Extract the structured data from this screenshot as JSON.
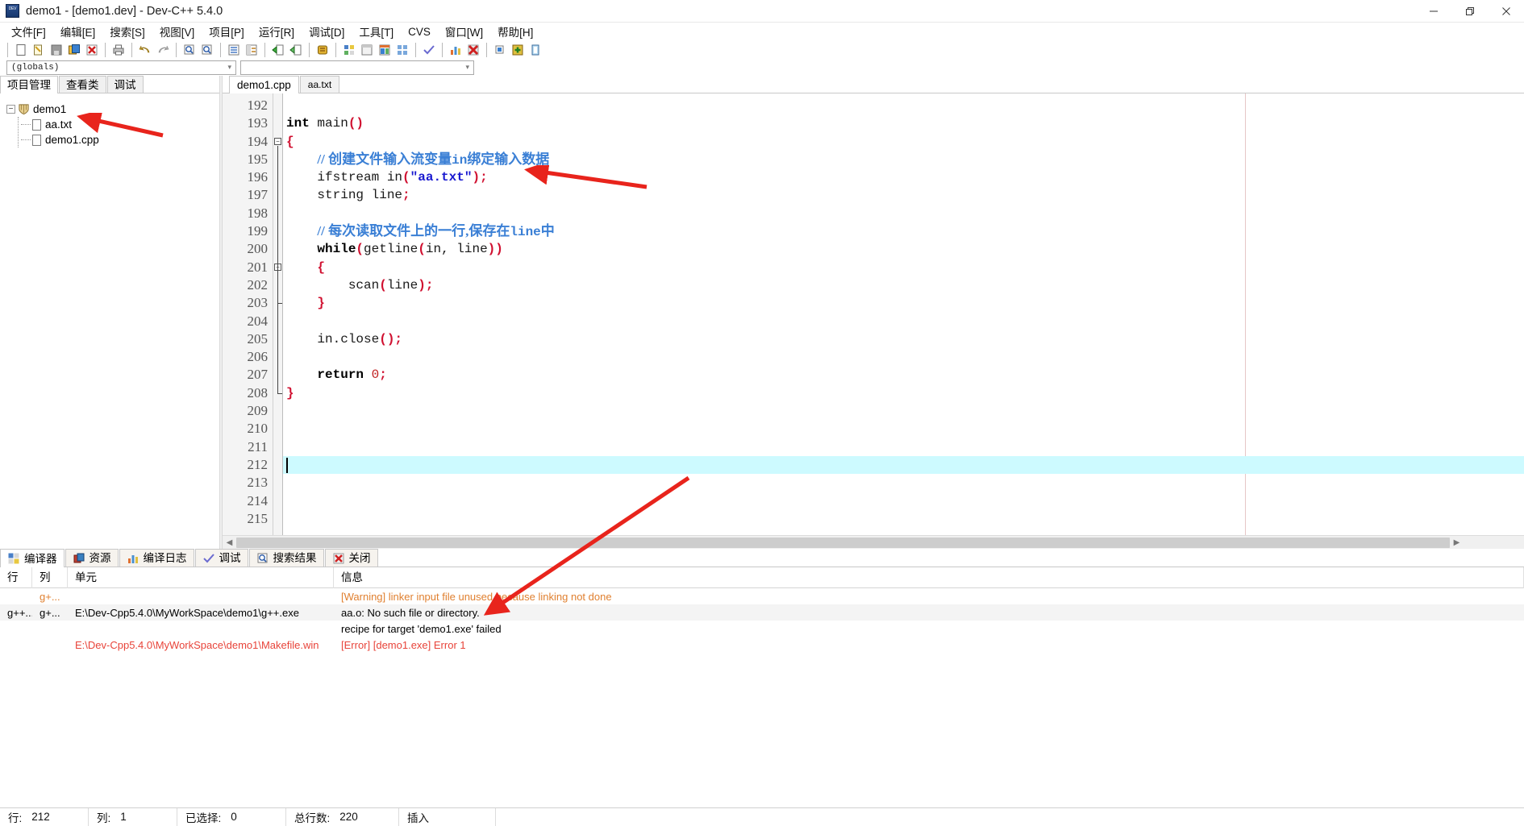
{
  "window": {
    "title": "demo1 - [demo1.dev] - Dev-C++ 5.4.0",
    "app_icon": "devcpp-icon",
    "controls": {
      "minimize": "—",
      "restore": "❐",
      "close": "✕"
    }
  },
  "menubar": {
    "items": [
      {
        "label": "文件[F]",
        "name": "menu-file"
      },
      {
        "label": "编辑[E]",
        "name": "menu-edit"
      },
      {
        "label": "搜索[S]",
        "name": "menu-search"
      },
      {
        "label": "视图[V]",
        "name": "menu-view"
      },
      {
        "label": "项目[P]",
        "name": "menu-project"
      },
      {
        "label": "运行[R]",
        "name": "menu-run"
      },
      {
        "label": "调试[D]",
        "name": "menu-debug"
      },
      {
        "label": "工具[T]",
        "name": "menu-tools"
      },
      {
        "label": "CVS",
        "name": "menu-cvs"
      },
      {
        "label": "窗口[W]",
        "name": "menu-window"
      },
      {
        "label": "帮助[H]",
        "name": "menu-help"
      }
    ]
  },
  "toolbar": {
    "buttons": [
      "new-file-icon",
      "open-file-icon",
      "save-file-icon",
      "save-all-icon",
      "close-file-icon",
      "print-icon",
      "sep",
      "undo-icon",
      "redo-icon",
      "sep",
      "find-icon",
      "find-next-icon",
      "goto-line-icon",
      "replace-icon",
      "sep",
      "compile-icon",
      "compile-run-icon",
      "sep",
      "stop-icon",
      "sep",
      "project-options-icon",
      "window-icon",
      "layout-icon",
      "grid-icon",
      "sep",
      "syntax-check-icon",
      "sep",
      "profile-icon",
      "debug-stop-icon",
      "sep",
      "insert-icon",
      "toggle-icon",
      "help-icon"
    ]
  },
  "combos": {
    "scope": {
      "value": "(globals)",
      "placeholder": "(globals)"
    },
    "member": {
      "value": "",
      "placeholder": ""
    }
  },
  "left_panel": {
    "tabs": [
      {
        "label": "项目管理",
        "name": "tab-project-manager",
        "active": true
      },
      {
        "label": "查看类",
        "name": "tab-class-browser",
        "active": false
      },
      {
        "label": "调试",
        "name": "tab-debug",
        "active": false
      }
    ],
    "tree": {
      "root": "demo1",
      "children": [
        "aa.txt",
        "demo1.cpp"
      ]
    }
  },
  "editor": {
    "tabs": [
      {
        "label": "demo1.cpp",
        "name": "editor-tab-demo1-cpp",
        "active": true
      },
      {
        "label": "aa.txt",
        "name": "editor-tab-aa-txt",
        "active": false
      }
    ],
    "first_line": 192,
    "current_line": 212,
    "lines": [
      {
        "n": 192,
        "tokens": []
      },
      {
        "n": 193,
        "tokens": [
          {
            "t": "int",
            "c": "kw"
          },
          {
            "t": " ",
            "c": "plain"
          },
          {
            "t": "main",
            "c": "plain"
          },
          {
            "t": "()",
            "c": "punc"
          }
        ]
      },
      {
        "n": 194,
        "fold": "open",
        "tokens": [
          {
            "t": "{",
            "c": "punc"
          }
        ]
      },
      {
        "n": 195,
        "tokens": [
          {
            "t": "    ",
            "c": "plain"
          },
          {
            "t": "// 创建文件输入流变量",
            "c": "cmt"
          },
          {
            "t": "in",
            "c": "cmt-mono"
          },
          {
            "t": "绑定输入数据",
            "c": "cmt"
          }
        ]
      },
      {
        "n": 196,
        "tokens": [
          {
            "t": "    ifstream in",
            "c": "plain"
          },
          {
            "t": "(",
            "c": "punc"
          },
          {
            "t": "\"aa.txt\"",
            "c": "str"
          },
          {
            "t": ")",
            "c": "punc"
          },
          {
            "t": ";",
            "c": "punc"
          }
        ]
      },
      {
        "n": 197,
        "tokens": [
          {
            "t": "    string line",
            "c": "plain"
          },
          {
            "t": ";",
            "c": "punc"
          }
        ]
      },
      {
        "n": 198,
        "tokens": []
      },
      {
        "n": 199,
        "tokens": [
          {
            "t": "    ",
            "c": "plain"
          },
          {
            "t": "// 每次读取文件上的一行,保存在",
            "c": "cmt"
          },
          {
            "t": "line",
            "c": "cmt-mono"
          },
          {
            "t": "中",
            "c": "cmt"
          }
        ]
      },
      {
        "n": 200,
        "tokens": [
          {
            "t": "    ",
            "c": "plain"
          },
          {
            "t": "while",
            "c": "kw"
          },
          {
            "t": "(",
            "c": "punc"
          },
          {
            "t": "getline",
            "c": "plain"
          },
          {
            "t": "(",
            "c": "punc"
          },
          {
            "t": "in, line",
            "c": "plain"
          },
          {
            "t": "))",
            "c": "punc"
          }
        ]
      },
      {
        "n": 201,
        "fold": "open",
        "tokens": [
          {
            "t": "    ",
            "c": "plain"
          },
          {
            "t": "{",
            "c": "punc"
          }
        ]
      },
      {
        "n": 202,
        "tokens": [
          {
            "t": "        scan",
            "c": "plain"
          },
          {
            "t": "(",
            "c": "punc"
          },
          {
            "t": "line",
            "c": "plain"
          },
          {
            "t": ")",
            "c": "punc"
          },
          {
            "t": ";",
            "c": "punc"
          }
        ]
      },
      {
        "n": 203,
        "fold": "end",
        "tokens": [
          {
            "t": "    ",
            "c": "plain"
          },
          {
            "t": "}",
            "c": "punc"
          }
        ]
      },
      {
        "n": 204,
        "tokens": []
      },
      {
        "n": 205,
        "tokens": [
          {
            "t": "    in.close",
            "c": "plain"
          },
          {
            "t": "()",
            "c": "punc"
          },
          {
            "t": ";",
            "c": "punc"
          }
        ]
      },
      {
        "n": 206,
        "tokens": []
      },
      {
        "n": 207,
        "tokens": [
          {
            "t": "    ",
            "c": "plain"
          },
          {
            "t": "return",
            "c": "kw"
          },
          {
            "t": " ",
            "c": "plain"
          },
          {
            "t": "0",
            "c": "num"
          },
          {
            "t": ";",
            "c": "punc"
          }
        ]
      },
      {
        "n": 208,
        "fold": "end",
        "tokens": [
          {
            "t": "}",
            "c": "punc"
          }
        ]
      },
      {
        "n": 209,
        "tokens": []
      },
      {
        "n": 210,
        "tokens": []
      },
      {
        "n": 211,
        "tokens": []
      },
      {
        "n": 212,
        "current": true,
        "tokens": []
      },
      {
        "n": 213,
        "tokens": []
      },
      {
        "n": 214,
        "tokens": []
      },
      {
        "n": 215,
        "tokens": []
      }
    ]
  },
  "bottom_panel": {
    "tabs": [
      {
        "label": "编译器",
        "icon": "compiler-icon",
        "name": "bottom-tab-compiler",
        "active": true
      },
      {
        "label": "资源",
        "icon": "resource-icon",
        "name": "bottom-tab-resource",
        "active": false
      },
      {
        "label": "编译日志",
        "icon": "log-icon",
        "name": "bottom-tab-compile-log",
        "active": false
      },
      {
        "label": "调试",
        "icon": "check-icon",
        "name": "bottom-tab-debug",
        "active": false
      },
      {
        "label": "搜索结果",
        "icon": "search-icon",
        "name": "bottom-tab-search-results",
        "active": false
      },
      {
        "label": "关闭",
        "icon": "close-icon",
        "name": "bottom-tab-close",
        "active": false
      }
    ],
    "columns": [
      "行",
      "列",
      "单元",
      "信息"
    ],
    "rows": [
      {
        "line": "",
        "col": "g+...",
        "unit": "",
        "msg": "[Warning] linker input file unused because linking not done",
        "style": "warn"
      },
      {
        "line": "g++....",
        "col": "g+...",
        "unit": "E:\\Dev-Cpp5.4.0\\MyWorkSpace\\demo1\\g++.exe",
        "msg": "aa.o: No such file or directory.",
        "style": "normal"
      },
      {
        "line": "",
        "col": "",
        "unit": "",
        "msg": "recipe for target 'demo1.exe' failed",
        "style": "normal"
      },
      {
        "line": "",
        "col": "",
        "unit": "E:\\Dev-Cpp5.4.0\\MyWorkSpace\\demo1\\Makefile.win",
        "msg": "[Error] [demo1.exe] Error 1",
        "style": "err"
      },
      {
        "line": "",
        "col": "",
        "unit": "",
        "msg": "",
        "style": "normal"
      }
    ]
  },
  "statusbar": {
    "row_label": "行:",
    "row_value": "212",
    "col_label": "列:",
    "col_value": "1",
    "sel_label": "已选择:",
    "sel_value": "0",
    "total_label": "总行数:",
    "total_value": "220",
    "mode": "插入"
  },
  "annotations": {
    "arrow_color": "#e8241c",
    "arrows": [
      "arrow-to-aa-txt-node",
      "arrow-to-ifstream-line",
      "arrow-to-compiler-message"
    ]
  }
}
